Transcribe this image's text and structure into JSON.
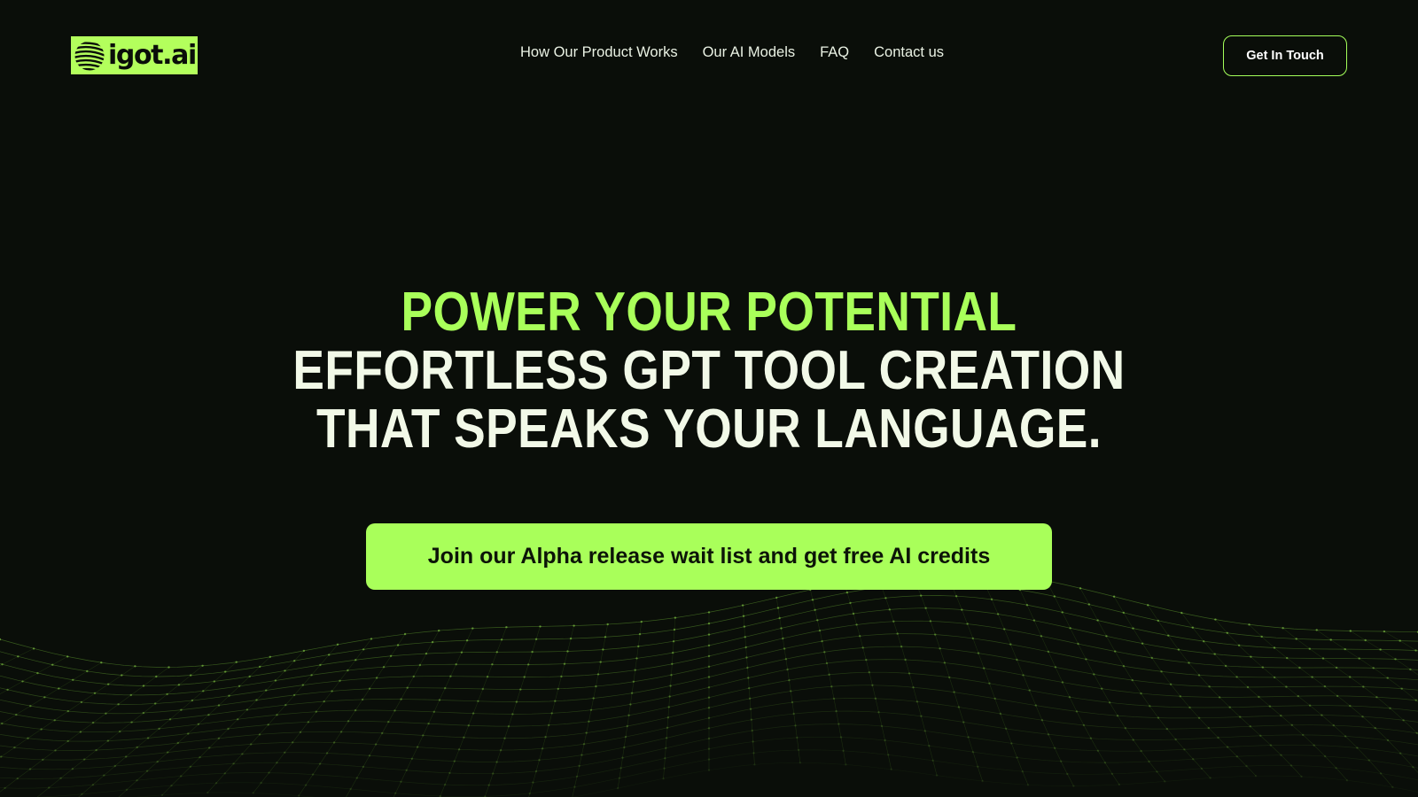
{
  "brand": {
    "name": "igot.ai",
    "logo_icon": "striped-globe-icon",
    "accent_color": "#a9ff5a",
    "background_color": "#0a0e09"
  },
  "nav": {
    "items": [
      {
        "label": "How Our Product Works"
      },
      {
        "label": "Our AI Models"
      },
      {
        "label": "FAQ"
      },
      {
        "label": "Contact us"
      }
    ]
  },
  "header": {
    "cta_label": "Get In Touch"
  },
  "hero": {
    "lines": [
      "POWER YOUR POTENTIAL",
      "EFFORTLESS GPT TOOL CREATION",
      "THAT SPEAKS YOUR LANGUAGE."
    ],
    "cta_label": "Join our Alpha release wait list and get free AI credits"
  }
}
